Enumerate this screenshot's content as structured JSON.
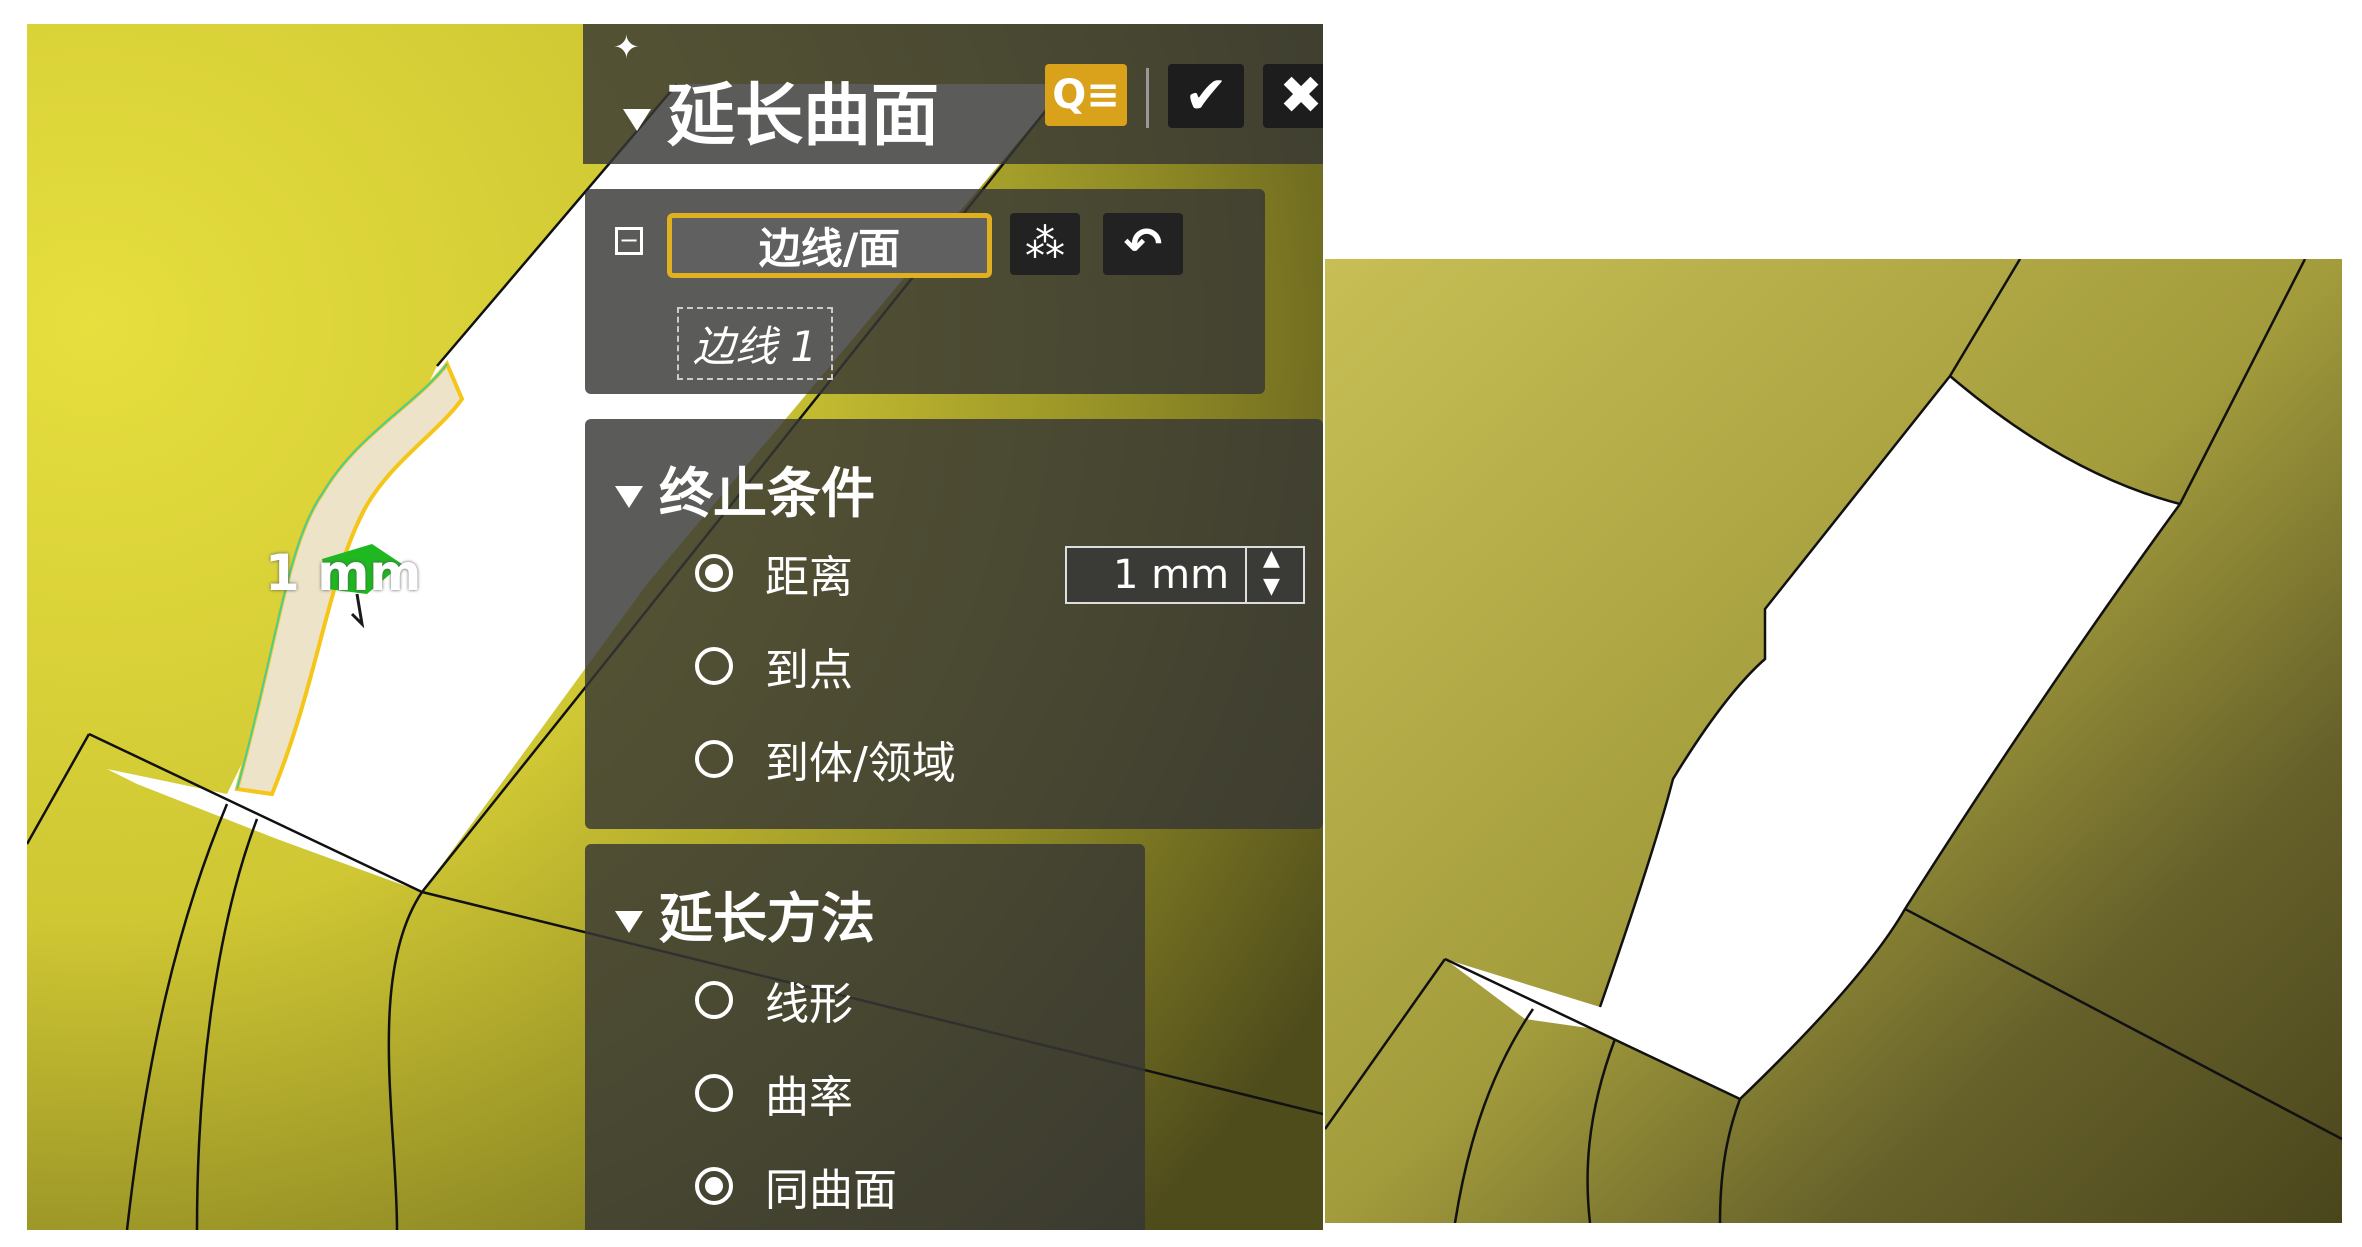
{
  "dialog": {
    "title": "延长曲面",
    "preview_icon": "preview-search-icon",
    "ok_icon": "checkmark-icon",
    "cancel_icon": "close-icon",
    "pin_icon": "pin-icon"
  },
  "selection": {
    "collapse_icon": "minus-box-icon",
    "edge_face_button": "边线/面",
    "propagate_icon": "propagate-icon",
    "undo_icon": "undo-icon",
    "selected_item": "边线 1"
  },
  "end_condition": {
    "header": "终止条件",
    "options": [
      {
        "label": "距离",
        "selected": true
      },
      {
        "label": "到点",
        "selected": false
      },
      {
        "label": "到体/领域",
        "selected": false
      }
    ],
    "distance_value": "1 mm"
  },
  "extend_method": {
    "header": "延长方法",
    "options": [
      {
        "label": "线形",
        "selected": false
      },
      {
        "label": "曲率",
        "selected": false
      },
      {
        "label": "同曲面",
        "selected": true
      }
    ]
  },
  "viewport": {
    "dimension_label": "1 mm",
    "colors": {
      "surface_light": "#e3dc3c",
      "surface_dark": "#4d4a1e",
      "selected_edge": "#f5c518",
      "drag_handle": "#1fb821",
      "panel_bg": "#3a3a36",
      "accent": "#e0b020"
    }
  }
}
